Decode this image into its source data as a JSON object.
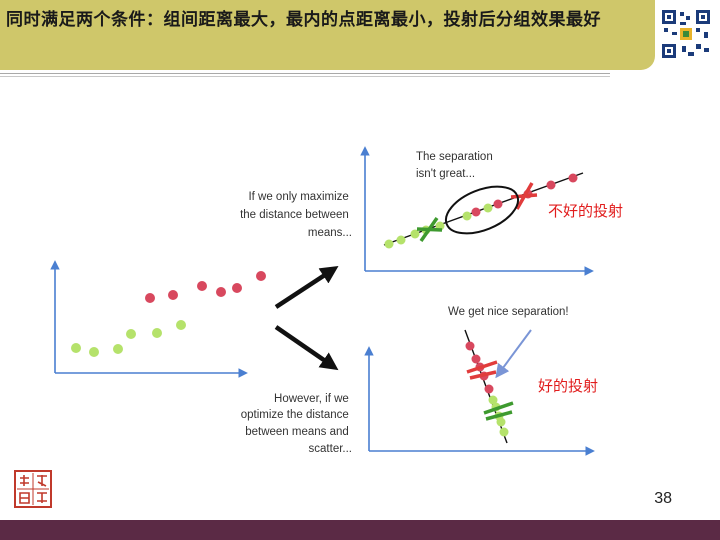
{
  "slide": {
    "title": "同时满足两个条件：组间距离最大，最内的点距离最小，投射后分组效果最好",
    "page_number": "38"
  },
  "figure": {
    "text_maximize": [
      "If we only maximize",
      "the distance between",
      "means..."
    ],
    "text_separation": [
      "The separation",
      "isn't great..."
    ],
    "text_however": [
      "However, if we",
      "optimize the distance",
      "between means and",
      "scatter..."
    ],
    "text_nice": "We get nice separation!",
    "label_bad": "不好的投射",
    "label_good": "好的投射"
  },
  "colors": {
    "title_bg": "#cfc76a",
    "bottom_bar": "#5b2a45",
    "green_point": "#b5e26b",
    "red_point": "#d8485e",
    "annotation_red": "#e11d1d",
    "axis_blue": "#4a7fd1"
  }
}
